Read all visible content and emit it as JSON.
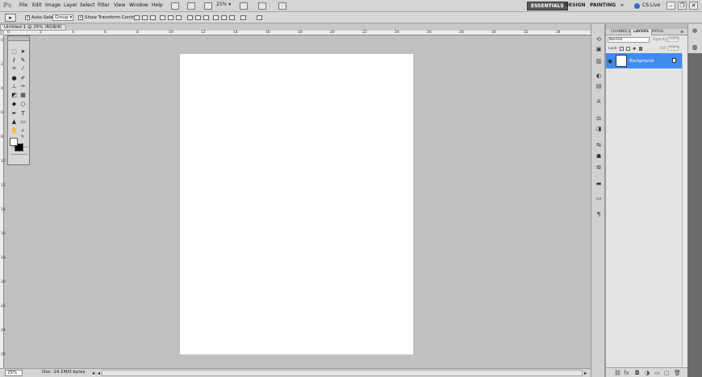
{
  "app": {
    "logo": "Ps"
  },
  "menu": [
    "File",
    "Edit",
    "Image",
    "Layer",
    "Select",
    "Filter",
    "View",
    "Window",
    "Help"
  ],
  "zoom_menu": "25%",
  "workspaces": {
    "essentials": "ESSENTIALS",
    "design": "DESIGN",
    "painting": "PAINTING",
    "more": "»"
  },
  "cslive": "CS Live",
  "window_buttons": {
    "minimize": "–",
    "restore": "❐",
    "close": "✕"
  },
  "options": {
    "auto_select_label": "Auto-Select:",
    "auto_select_value": "Group",
    "show_transform_label": "Show Transform Controls"
  },
  "document": {
    "tab_label": "Untitled-1 @ 25% (RGB/8)",
    "tab_close": "×",
    "ruler_ticks": [
      "0",
      "2",
      "4",
      "6",
      "8",
      "10",
      "12",
      "14",
      "16",
      "18",
      "20",
      "22",
      "24",
      "26",
      "28",
      "30",
      "32",
      "34"
    ],
    "ruler_left_ticks": [
      "0",
      "2",
      "4",
      "6",
      "8",
      "10",
      "12",
      "14",
      "16",
      "18",
      "20",
      "22",
      "24",
      "26"
    ]
  },
  "status": {
    "zoom": "25%",
    "doc_size": "Doc: 24.1M/0 bytes"
  },
  "layers_panel": {
    "tabs": [
      "CHANNELS",
      "LAYERS",
      "PATHS"
    ],
    "blend_mode": "Normal",
    "opacity_label": "Opacity:",
    "opacity_value": "100%",
    "lock_label": "Lock:",
    "fill_label": "Fill:",
    "fill_value": "100%",
    "layers": [
      {
        "name": "Background",
        "selected": true,
        "locked": true
      }
    ]
  },
  "colors": {
    "selection_blue": "#3f8cf0",
    "canvas_gray": "#c0c0c0",
    "essentials_bg": "#5a5a5a"
  }
}
